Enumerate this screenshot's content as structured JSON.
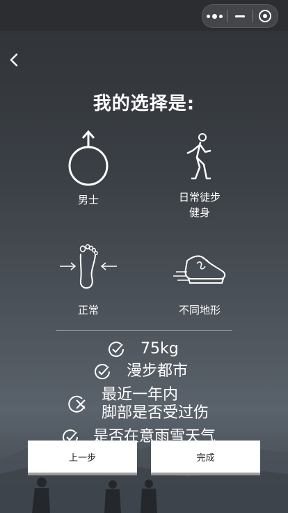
{
  "page": {
    "title": "我的选择是:"
  },
  "options": [
    {
      "label": "男士",
      "icon": "male-symbol-icon"
    },
    {
      "label": "日常徒步\n健身",
      "icon": "runner-icon"
    },
    {
      "label": "正常",
      "icon": "footprint-icon"
    },
    {
      "label": "不同地形",
      "icon": "sneaker-icon"
    }
  ],
  "summary": {
    "weight": "75kg",
    "scene": "漫步都市",
    "injury_line1": "最近一年内",
    "injury_line2": "脚部是否受过伤",
    "weather": "是否在意雨雪天气"
  },
  "buttons": {
    "prev": "上一步",
    "done": "完成"
  },
  "colors": {
    "text": "#ffffff",
    "button_bg": "#ffffff",
    "button_text": "#222222"
  }
}
